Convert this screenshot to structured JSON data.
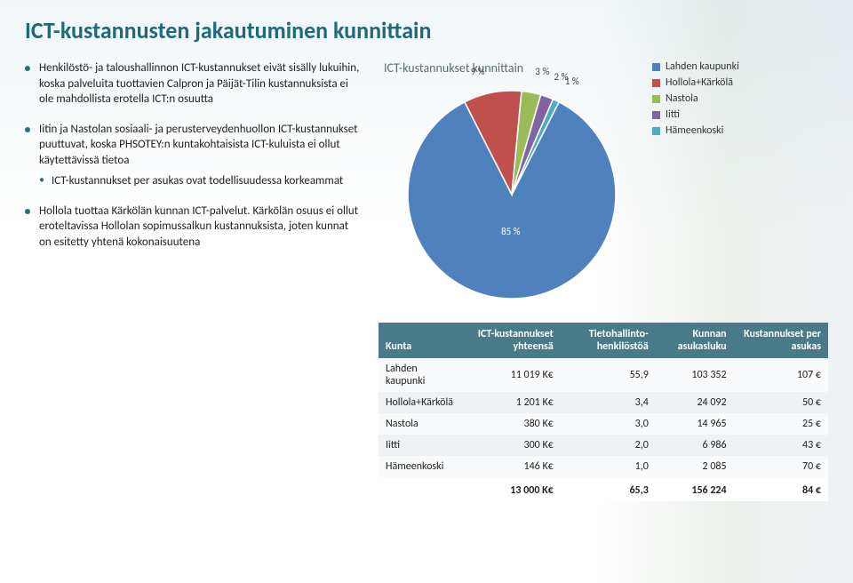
{
  "title": "ICT-kustannusten jakautuminen kunnittain",
  "bullets": {
    "b1": "Henkilöstö- ja taloushallinnon ICT-kustannukset eivät sisälly lukuihin, koska palveluita tuottavien Calpron ja Päijät-Tilin kustannuksista ei ole mahdollista erotella ICT:n osuutta",
    "b2": "Iitin ja Nastolan sosiaali- ja perusterveydenhuollon ICT-kustannukset puuttuvat, koska PHSOTEY:n kuntakohtaisista ICT-kuluista ei ollut käytettävissä tietoa",
    "b2sub": "ICT-kustannukset per asukas ovat todellisuudessa korkeammat",
    "b3": "Hollola tuottaa Kärkölän kunnan ICT-palvelut. Kärkölän osuus ei ollut eroteltavissa Hollolan sopimussalkun kustannuksista, joten kunnat on esitetty yhtenä kokonaisuutena"
  },
  "chart_data": {
    "type": "pie",
    "title": "ICT-kustannukset kunnittain",
    "series": [
      {
        "name": "Lahden kaupunki",
        "value": 85,
        "color": "#4f81bd"
      },
      {
        "name": "Hollola+Kärkölä",
        "value": 9,
        "color": "#c0504d"
      },
      {
        "name": "Nastola",
        "value": 3,
        "color": "#9bbb59"
      },
      {
        "name": "Iitti",
        "value": 2,
        "color": "#8064a2"
      },
      {
        "name": "Hämeenkoski",
        "value": 1,
        "color": "#4bacc6"
      }
    ],
    "value_suffix": " %"
  },
  "legend": [
    {
      "label": "Lahden kaupunki",
      "color": "#4f81bd"
    },
    {
      "label": "Hollola+Kärkölä",
      "color": "#c0504d"
    },
    {
      "label": "Nastola",
      "color": "#9bbb59"
    },
    {
      "label": "Iitti",
      "color": "#8064a2"
    },
    {
      "label": "Hämeenkoski",
      "color": "#4bacc6"
    }
  ],
  "table": {
    "headers": {
      "c0": "Kunta",
      "c1": "ICT-kustannukset yhteensä",
      "c2": "Tietohallinto-henkilöstöä",
      "c3": "Kunnan asukasluku",
      "c4": "Kustannukset per asukas"
    },
    "rows": [
      {
        "c0": "Lahden kaupunki",
        "c1": "11 019 K€",
        "c2": "55,9",
        "c3": "103 352",
        "c4": "107 €"
      },
      {
        "c0": "Hollola+Kärkölä",
        "c1": "1 201 K€",
        "c2": "3,4",
        "c3": "24 092",
        "c4": "50 €"
      },
      {
        "c0": "Nastola",
        "c1": "380 K€",
        "c2": "3,0",
        "c3": "14 965",
        "c4": "25 €"
      },
      {
        "c0": "Iitti",
        "c1": "300 K€",
        "c2": "2,0",
        "c3": "6 986",
        "c4": "43 €"
      },
      {
        "c0": "Hämeenkoski",
        "c1": "146 K€",
        "c2": "1,0",
        "c3": "2 085",
        "c4": "70 €"
      }
    ],
    "totals": {
      "c0": "",
      "c1": "13 000 K€",
      "c2": "65,3",
      "c3": "156 224",
      "c4": "84 €"
    }
  }
}
